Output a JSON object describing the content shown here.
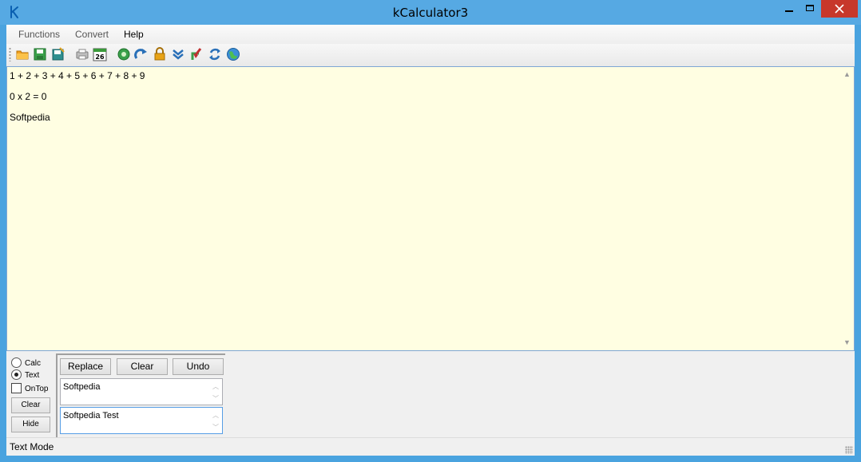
{
  "window": {
    "title": "kCalculator3",
    "close_glyph": "✕",
    "accent": "#56a9e3",
    "close_color": "#c7382b"
  },
  "menu": {
    "items": [
      "Functions",
      "Convert",
      "Help"
    ]
  },
  "toolbar": {
    "icons": [
      "open-folder-icon",
      "save-icon",
      "save-as-icon",
      "print-icon",
      "calendar-icon",
      "settings-icon",
      "redo-icon",
      "lock-icon",
      "chevron-down-icon",
      "import-icon",
      "refresh-icon",
      "globe-icon"
    ],
    "calendar_day": "26"
  },
  "editor": {
    "lines": [
      "1 + 2 + 3 + 4 + 5 + 6 + 7 + 8 + 9",
      "0  x 2 = 0",
      "Softpedia"
    ],
    "background": "#fffee2"
  },
  "options": {
    "calc_label": "Calc",
    "text_label": "Text",
    "ontop_label": "OnTop",
    "selected_mode": "Text",
    "clear_label": "Clear",
    "hide_label": "Hide"
  },
  "replace": {
    "replace_label": "Replace",
    "clear_label": "Clear",
    "undo_label": "Undo",
    "find_value": "Softpedia",
    "replace_value": "Softpedia Test"
  },
  "status": {
    "text": "Text Mode"
  }
}
